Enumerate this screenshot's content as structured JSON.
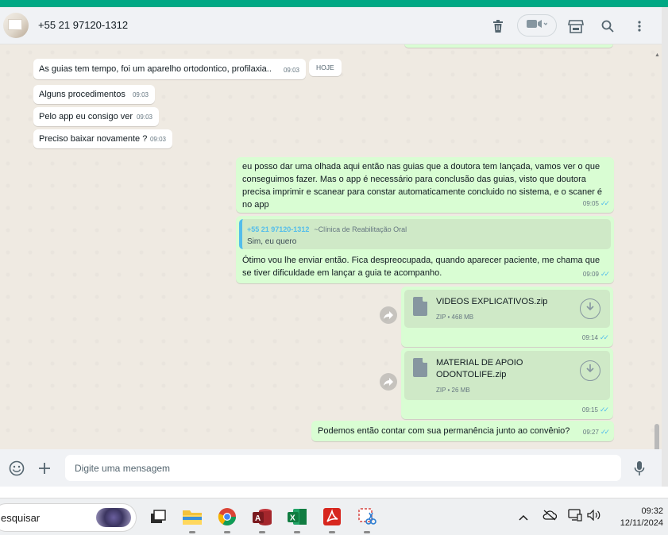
{
  "header": {
    "contact_name": "+55 21 97120-1312"
  },
  "day_label": "HOJE",
  "incoming": [
    {
      "text": "As guias tem tempo, foi um aparelho ortodontico, profilaxia..",
      "time": "09:03"
    },
    {
      "text": "Alguns procedimentos",
      "time": "09:03"
    },
    {
      "text": "Pelo app eu consigo ver",
      "time": "09:03"
    },
    {
      "text": "Preciso baixar novamente ?",
      "time": "09:03"
    }
  ],
  "outgoing": {
    "msg1": {
      "text": "eu posso dar uma olhada aqui então nas guias que a doutora tem lançada, vamos ver o que conseguimos fazer. Mas o app é necessário para conclusão das guias, visto que doutora precisa imprimir e scanear para constar automaticamente concluido no sistema, e o scaner é no app",
      "time": "09:05"
    },
    "reply": {
      "quoted_name": "+55 21 97120-1312",
      "quoted_org": "~Clínica de Reabilitação Oral",
      "quoted_text": "Sim, eu quero",
      "text": "Ótimo vou lhe enviar então. Fica despreocupada, quando aparecer paciente, me chama que se tiver dificuldade em lançar a guia te acompanho.",
      "time": "09:09"
    },
    "file1": {
      "name": "VIDEOS EXPLICATIVOS.zip",
      "meta": "ZIP • 468 MB",
      "time": "09:14"
    },
    "file2": {
      "name_line1": "MATERIAL DE APOIO",
      "name_line2": "ODONTOLIFE.zip",
      "meta": "ZIP • 26 MB",
      "time": "09:15"
    },
    "msg_last": {
      "text": "Podemos então contar com sua permanência junto ao convênio?",
      "time": "09:27"
    }
  },
  "composer": {
    "placeholder": "Digite uma mensagem"
  },
  "taskbar": {
    "search_text": "esquisar",
    "time": "09:32",
    "date": "12/11/2024"
  },
  "colors": {
    "accent": "#00a884",
    "outgoing_bubble": "#d9fdd3",
    "read_ticks": "#53bdeb"
  }
}
